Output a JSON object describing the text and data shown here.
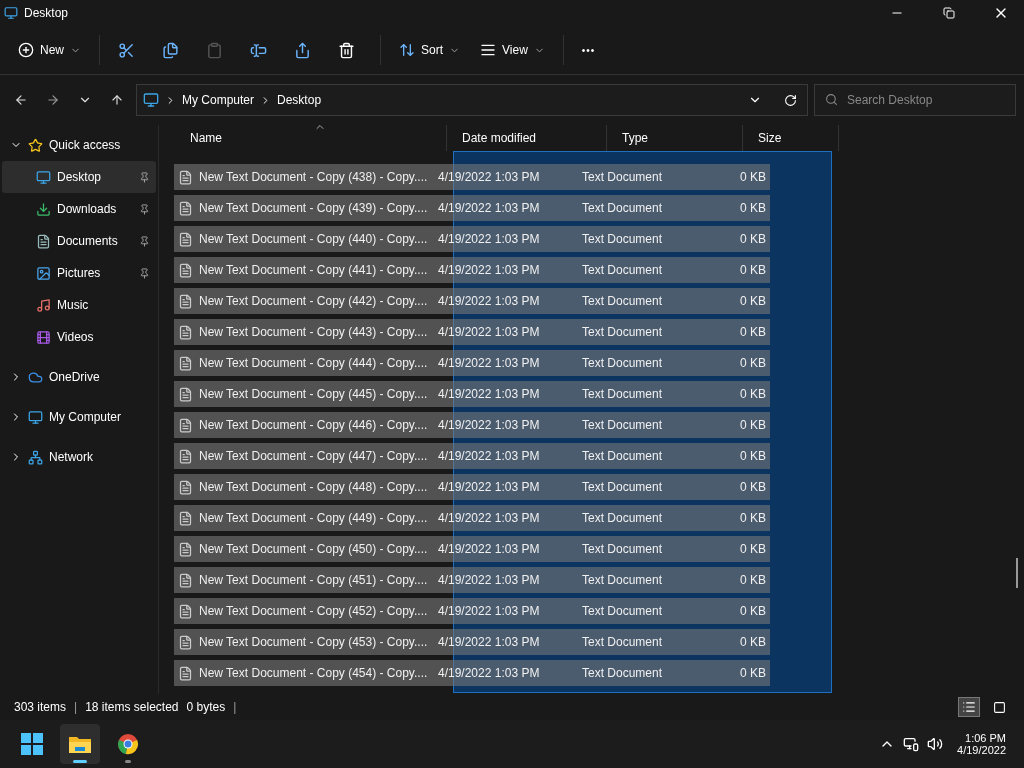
{
  "window": {
    "title": "Desktop"
  },
  "toolbar": {
    "items": [
      {
        "kind": "menu",
        "label": "New"
      },
      {
        "kind": "icon",
        "disabled": false
      },
      {
        "kind": "icon",
        "disabled": false
      },
      {
        "kind": "icon",
        "disabled": true
      },
      {
        "kind": "icon",
        "disabled": false
      },
      {
        "kind": "icon",
        "disabled": false
      },
      {
        "kind": "icon",
        "disabled": false
      },
      {
        "kind": "menu",
        "label": "Sort"
      },
      {
        "kind": "menu",
        "label": "View"
      },
      {
        "kind": "more",
        "label": "•••"
      }
    ]
  },
  "address": {
    "path": [
      "My Computer",
      "Desktop"
    ]
  },
  "search": {
    "placeholder": "Search Desktop"
  },
  "sidebar": {
    "items": [
      {
        "label": "Quick access",
        "expanded": true,
        "selected": false,
        "children": [
          {
            "label": "Desktop",
            "pinned": true,
            "selected": true
          },
          {
            "label": "Downloads",
            "pinned": true,
            "selected": false
          },
          {
            "label": "Documents",
            "pinned": true,
            "selected": false
          },
          {
            "label": "Pictures",
            "pinned": true,
            "selected": false
          },
          {
            "label": "Music",
            "pinned": false,
            "selected": false
          },
          {
            "label": "Videos",
            "pinned": false,
            "selected": false
          }
        ]
      },
      {
        "label": "OneDrive",
        "expanded": false,
        "selected": false
      },
      {
        "label": "My Computer",
        "expanded": false,
        "selected": false
      },
      {
        "label": "Network",
        "expanded": false,
        "selected": false
      }
    ]
  },
  "table": {
    "columns": [
      "Name",
      "Date modified",
      "Type",
      "Size"
    ],
    "rows": [
      {
        "name": "New Text Document - Copy (438) - Copy....",
        "date": "4/19/2022 1:03 PM",
        "type": "Text Document",
        "size": "0 KB",
        "selected": true
      },
      {
        "name": "New Text Document - Copy (439) - Copy....",
        "date": "4/19/2022 1:03 PM",
        "type": "Text Document",
        "size": "0 KB",
        "selected": true
      },
      {
        "name": "New Text Document - Copy (440) - Copy....",
        "date": "4/19/2022 1:03 PM",
        "type": "Text Document",
        "size": "0 KB",
        "selected": true
      },
      {
        "name": "New Text Document - Copy (441) - Copy....",
        "date": "4/19/2022 1:03 PM",
        "type": "Text Document",
        "size": "0 KB",
        "selected": true
      },
      {
        "name": "New Text Document - Copy (442) - Copy....",
        "date": "4/19/2022 1:03 PM",
        "type": "Text Document",
        "size": "0 KB",
        "selected": true
      },
      {
        "name": "New Text Document - Copy (443) - Copy....",
        "date": "4/19/2022 1:03 PM",
        "type": "Text Document",
        "size": "0 KB",
        "selected": true
      },
      {
        "name": "New Text Document - Copy (444) - Copy....",
        "date": "4/19/2022 1:03 PM",
        "type": "Text Document",
        "size": "0 KB",
        "selected": true
      },
      {
        "name": "New Text Document - Copy (445) - Copy....",
        "date": "4/19/2022 1:03 PM",
        "type": "Text Document",
        "size": "0 KB",
        "selected": true
      },
      {
        "name": "New Text Document - Copy (446) - Copy....",
        "date": "4/19/2022 1:03 PM",
        "type": "Text Document",
        "size": "0 KB",
        "selected": true
      },
      {
        "name": "New Text Document - Copy (447) - Copy....",
        "date": "4/19/2022 1:03 PM",
        "type": "Text Document",
        "size": "0 KB",
        "selected": true
      },
      {
        "name": "New Text Document - Copy (448) - Copy....",
        "date": "4/19/2022 1:03 PM",
        "type": "Text Document",
        "size": "0 KB",
        "selected": true
      },
      {
        "name": "New Text Document - Copy (449) - Copy....",
        "date": "4/19/2022 1:03 PM",
        "type": "Text Document",
        "size": "0 KB",
        "selected": true
      },
      {
        "name": "New Text Document - Copy (450) - Copy....",
        "date": "4/19/2022 1:03 PM",
        "type": "Text Document",
        "size": "0 KB",
        "selected": true
      },
      {
        "name": "New Text Document - Copy (451) - Copy....",
        "date": "4/19/2022 1:03 PM",
        "type": "Text Document",
        "size": "0 KB",
        "selected": true
      },
      {
        "name": "New Text Document - Copy (452) - Copy....",
        "date": "4/19/2022 1:03 PM",
        "type": "Text Document",
        "size": "0 KB",
        "selected": true
      },
      {
        "name": "New Text Document - Copy (453) - Copy....",
        "date": "4/19/2022 1:03 PM",
        "type": "Text Document",
        "size": "0 KB",
        "selected": true
      },
      {
        "name": "New Text Document - Copy (454) - Copy....",
        "date": "4/19/2022 1:03 PM",
        "type": "Text Document",
        "size": "0 KB",
        "selected": true
      }
    ]
  },
  "status_bar": {
    "items": [
      {
        "kind": "text",
        "label": "303 items"
      },
      {
        "kind": "separator",
        "label": "|"
      },
      {
        "kind": "text",
        "label": "18 items selected"
      },
      {
        "kind": "text",
        "label": "0 bytes"
      },
      {
        "kind": "separator",
        "label": "|"
      }
    ],
    "view_buttons": [
      {
        "selected": true
      },
      {
        "selected": false
      }
    ]
  },
  "taskbar": {
    "apps": [
      {
        "kind": "folder",
        "selected": true
      },
      {
        "kind": "browser",
        "selected": false
      }
    ],
    "time": "1:06 PM",
    "date": "4/19/2022"
  }
}
